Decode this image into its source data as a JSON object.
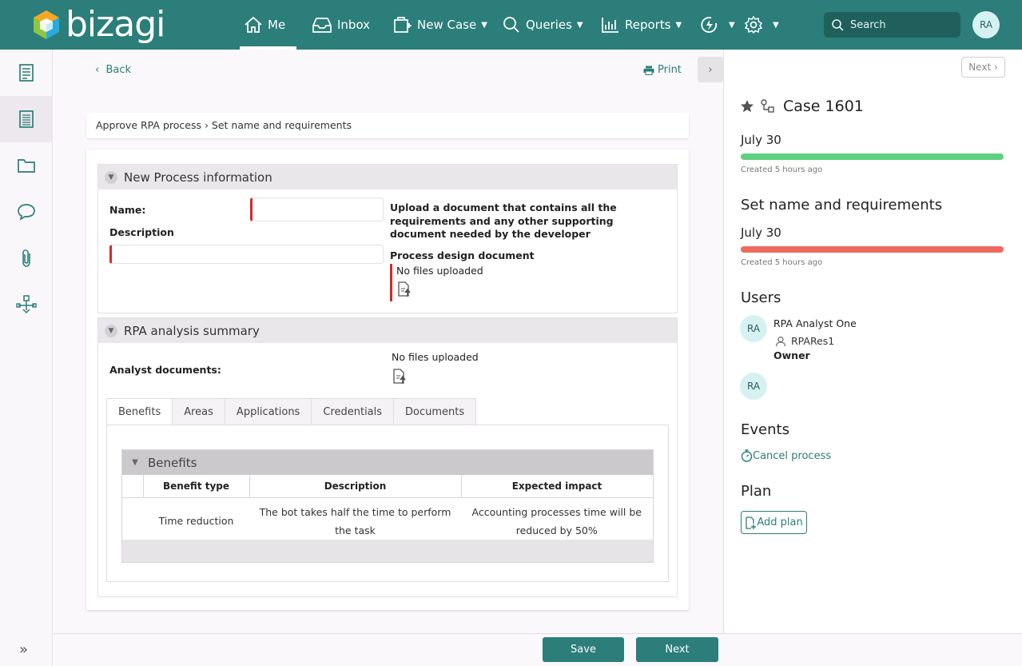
{
  "app": {
    "brand": "bizagi",
    "accent_color": "#2b7e7a"
  },
  "topnav": {
    "items": [
      {
        "label": "Me",
        "icon": "home-icon"
      },
      {
        "label": "Inbox",
        "icon": "inbox-icon"
      },
      {
        "label": "New Case",
        "icon": "new-case-icon"
      },
      {
        "label": "Queries",
        "icon": "search-icon"
      },
      {
        "label": "Reports",
        "icon": "chart-icon"
      }
    ],
    "search_placeholder": "Search",
    "avatar_initials": "RA"
  },
  "sidebar": {
    "icons": [
      "document-icon",
      "list-document-icon",
      "folder-icon",
      "chat-icon",
      "paperclip-icon",
      "process-map-icon"
    ]
  },
  "main": {
    "back_label": "Back",
    "print_label": "Print",
    "breadcrumb": "Approve RPA process › Set name and requirements",
    "group1": {
      "title": "New Process information",
      "name_label": "Name:",
      "description_label": "Description",
      "upload_text": "Upload a document that contains all the requirements and any other supporting document needed by the developer",
      "doc_label": "Process design document",
      "no_files": "No files uploaded"
    },
    "group2": {
      "title": "RPA analysis summary",
      "analyst_label": "Analyst documents:",
      "no_files": "No files uploaded",
      "tabs": [
        "Benefits",
        "Areas",
        "Applications",
        "Credentials",
        "Documents"
      ],
      "grid": {
        "title": "Benefits",
        "columns": [
          "Benefit type",
          "Description",
          "Expected impact"
        ],
        "rows": [
          [
            "Time reduction",
            "The bot takes half the time to perform the task",
            "Accounting processes time will be reduced by 50%"
          ]
        ]
      }
    }
  },
  "bottom": {
    "save_label": "Save",
    "next_label": "Next"
  },
  "right": {
    "next_label": "Next",
    "case_title": "Case 1601",
    "case_date": "July 30",
    "case_created": "Created 5 hours ago",
    "case_color": "#5fcf80",
    "task_title": "Set name and requirements",
    "task_date": "July 30",
    "task_created": "Created 5 hours ago",
    "task_color": "#ee6a60",
    "users_title": "Users",
    "user1": {
      "initials": "RA",
      "name": "RPA Analyst One",
      "role_user": "RPARes1",
      "role": "Owner"
    },
    "user2": {
      "initials": "RA"
    },
    "events_title": "Events",
    "event_cancel": "Cancel process",
    "plan_title": "Plan",
    "add_plan": "Add plan"
  }
}
